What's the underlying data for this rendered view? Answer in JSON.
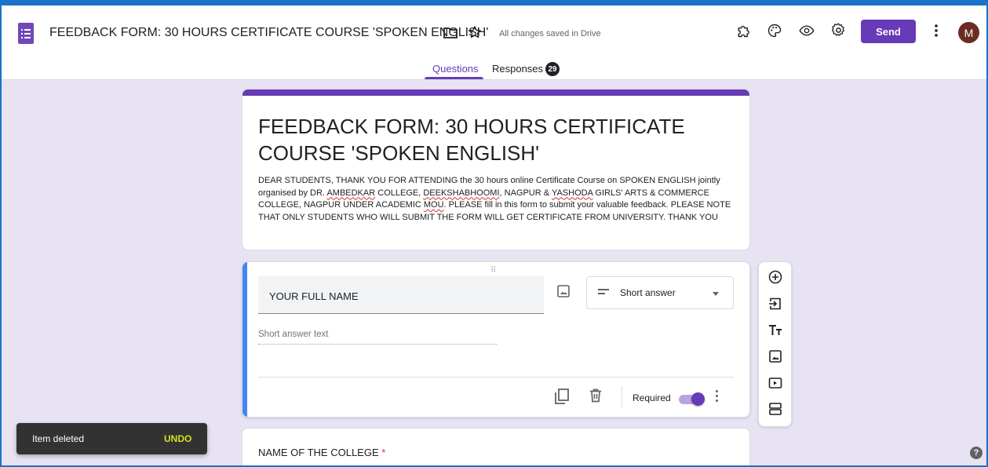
{
  "header": {
    "doc_title": "FEEDBACK FORM: 30 HOURS CERTIFICATE COURSE 'SPOKEN ENGLISH'",
    "saved_status": "All changes saved in Drive",
    "send_label": "Send",
    "avatar_letter": "M",
    "accent_color": "#673ab7"
  },
  "tabs": {
    "questions": "Questions",
    "responses": "Responses",
    "responses_count": "29"
  },
  "form": {
    "title": "FEEDBACK FORM: 30 HOURS CERTIFICATE COURSE 'SPOKEN ENGLISH'",
    "description": {
      "p1": "DEAR STUDENTS, THANK YOU FOR ATTENDING the 30 hours online Certificate Course on SPOKEN ENGLISH jointly organised by DR. ",
      "w1": "AMBEDKAR",
      "p2": " COLLEGE, ",
      "w2": "DEEKSHABHOOMI",
      "p3": ", NAGPUR & ",
      "w3": "YASHODA",
      "p4": " GIRLS' ARTS & COMMERCE COLLEGE, NAGPUR UNDER ACADEMIC ",
      "w4": "MOU",
      "p5": ". PLEASE fill in this form to submit your valuable feedback. PLEASE NOTE THAT ONLY STUDENTS WHO WILL SUBMIT THE FORM WILL GET CERTIFICATE FROM UNIVERSITY. THANK YOU"
    }
  },
  "question1": {
    "title": "YOUR FULL NAME",
    "type": "Short answer",
    "answer_placeholder": "Short answer text",
    "required_label": "Required",
    "required": true
  },
  "question2": {
    "title": "NAME OF THE COLLEGE",
    "required_mark": "*"
  },
  "snackbar": {
    "message": "Item deleted",
    "action": "UNDO"
  },
  "help": "?"
}
